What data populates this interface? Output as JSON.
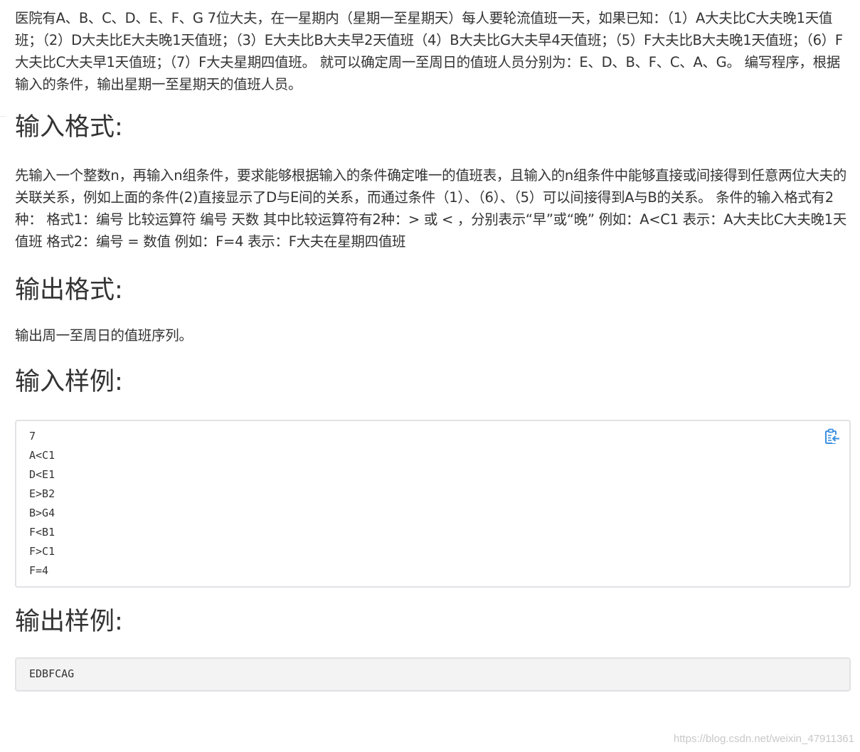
{
  "problem": {
    "description": "医院有A、B、C、D、E、F、G 7位大夫，在一星期内（星期一至星期天）每人要轮流值班一天，如果已知：（1）A大夫比C大夫晚1天值班；（2）D大夫比E大夫晚1天值班；（3）E大夫比B大夫早2天值班（4）B大夫比G大夫早4天值班；（5）F大夫比B大夫晚1天值班；（6）F大夫比C大夫早1天值班；（7）F大夫星期四值班。 就可以确定周一至周日的值班人员分别为：E、D、B、F、C、A、G。 编写程序，根据输入的条件，输出星期一至星期天的值班人员。"
  },
  "input_format": {
    "heading": "输入格式:",
    "text": "先输入一个整数n，再输入n组条件，要求能够根据输入的条件确定唯一的值班表，且输入的n组条件中能够直接或间接得到任意两位大夫的关联关系，例如上面的条件(2)直接显示了D与E间的关系，而通过条件（1）、（6）、（5）可以间接得到A与B的关系。 条件的输入格式有2种： 格式1：编号 比较运算符 编号 天数 其中比较运算符有2种：> 或 < ，分别表示“早”或“晚” 例如：A<C1 表示：A大夫比C大夫晚1天值班 格式2：编号 = 数值 例如：F=4 表示：F大夫在星期四值班"
  },
  "output_format": {
    "heading": "输出格式:",
    "text": "输出周一至周日的值班序列。"
  },
  "sample_input": {
    "heading": "输入样例:",
    "code": "7\nA<C1\nD<E1\nE>B2\nB>G4\nF<B1\nF>C1\nF=4",
    "copy_icon": "clipboard-copy-icon",
    "accent_color": "#3b8fe0"
  },
  "sample_output": {
    "heading": "输出样例:",
    "code": "EDBFCAG"
  },
  "watermark": {
    "text": "https://blog.csdn.net/weixin_47911361"
  }
}
